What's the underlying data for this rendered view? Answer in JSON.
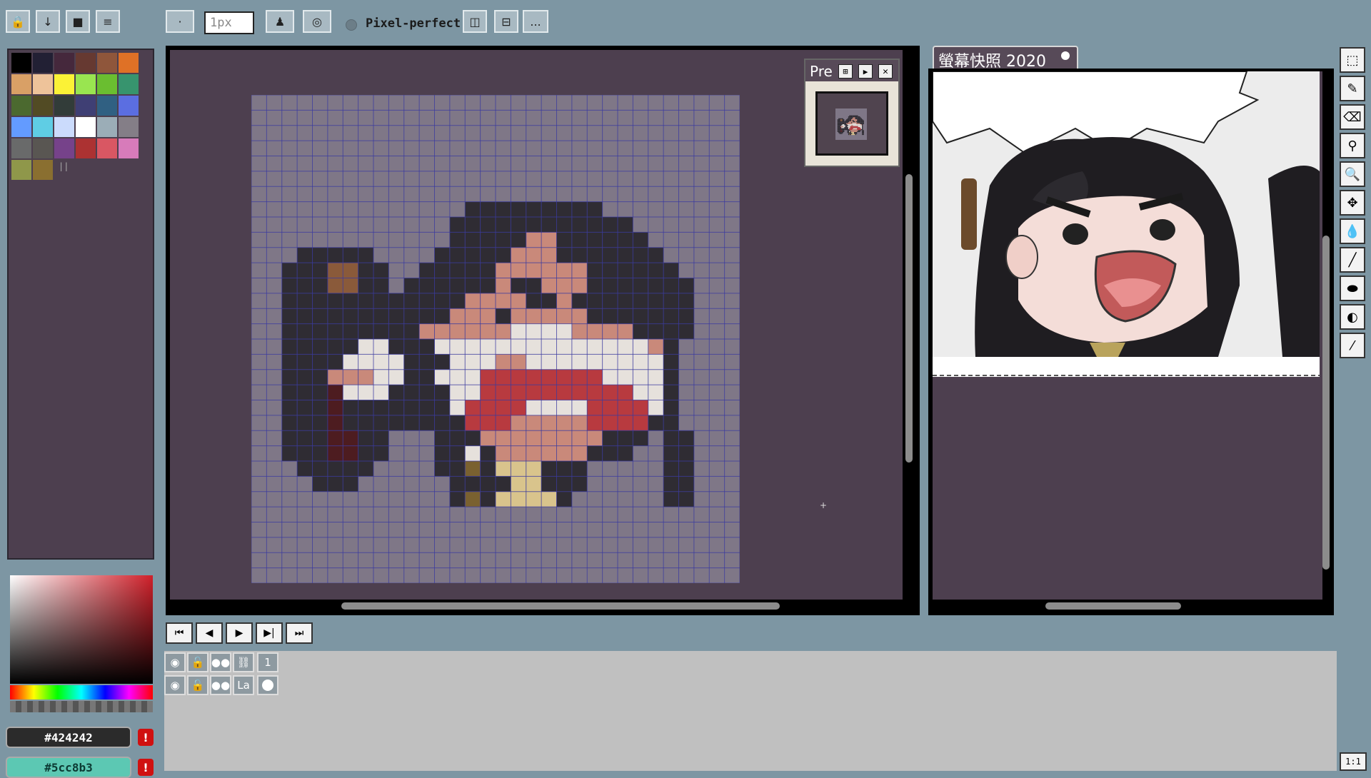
{
  "toolbar": {
    "brush_size_value": "1px",
    "pixel_perfect_label": "Pixel-perfect",
    "more_label": "..."
  },
  "palette": {
    "colors": [
      "#000000",
      "#222034",
      "#45283c",
      "#663931",
      "#8f563b",
      "#df7126",
      "#d9a066",
      "#eec39a",
      "#fbf236",
      "#99e550",
      "#6abe30",
      "#37946e",
      "#4b692f",
      "#524b24",
      "#323c39",
      "#3f3f74",
      "#306082",
      "#5b6ee1",
      "#639bff",
      "#5fcde4",
      "#cbdbfc",
      "#ffffff",
      "#9badb7",
      "#847e87",
      "#696a6a",
      "#595652",
      "#76428a",
      "#ac3232",
      "#d95763",
      "#d77bba",
      "#8f974a",
      "#8a6f30"
    ],
    "grip_label": "||"
  },
  "color_picker": {
    "hue_color": "#d0202a",
    "primary_hex": "#424242",
    "secondary_hex": "#5cc8b3",
    "warning_mark": "!"
  },
  "preview_panel": {
    "title": "Pre"
  },
  "reference_tab": {
    "title": "螢幕快照 2020"
  },
  "layers": [
    {
      "name": "1"
    },
    {
      "name": "La"
    }
  ],
  "bottom_right": {
    "zoom_label": "1:1"
  },
  "pixel_art": {
    "grid_cols": 32,
    "grid_rows": 32,
    "background": "#7f7787",
    "grid_line_color": "#3a3aa0",
    "legend": {
      "k": "#2f2c33",
      "d": "#242228",
      "m": "#3d3a42",
      "h": "#8a5a3a",
      "s": "#c9897a",
      "p": "#d9a8a0",
      "w": "#e6e1dc",
      "r": "#b83a3f",
      "R": "#8e2c33",
      "n": "#4d1c20",
      "y": "#d9c48c",
      "o": "#7a6130",
      "g": "#7d7885"
    },
    "rows": [
      "................................",
      "................................",
      "................................",
      "................................",
      "................................",
      "................................",
      "................................",
      "..............kkkkkkkkk.........",
      ".............kkkkkkkkkkkk.......",
      ".............kkkkksskkkkkk......",
      "...kkkkk....kkkkkssskkkkkkk.....",
      "..kkkhhkk..kkkkksssssskkkkkk....",
      "..kkkhhkk.kkkkkkskkssskkkkkkk...",
      "..kkkkkkkkkkkksssskkskkkkkkkk...",
      "..kkkkkkkkkkkssskssssskkkkkkk...",
      "..kkkkkkkkksssssswwwwsssskkkk...",
      "..kkkkkwwkkkwwwwwwwwwwwwwwsk....",
      "..kkkkwwwwkkkwwwsswwwwwwwwwk....",
      "..kkkssswwkkwwwrrrrrrrrwwwwk....",
      "..kkknwwwkkkkwwrrrrrrrrrrwwk....",
      "..kkknkkkkkkkwrrrrwwwwrrrrwk....",
      "..kkknkkkkkkkkrrrsssssrrrrkk....",
      "..kkknnkk...kkksssssssskkk.kk...",
      "..kkknnkk...kkwksssssskkk..kk...",
      "...kkkkk....kkokyyykkk.....kk...",
      "....kkk......kkkkyykkk.....kk...",
      ".............kokyyyyk......kk...",
      "................................",
      "................................",
      "................................",
      "................................",
      "................................"
    ]
  }
}
